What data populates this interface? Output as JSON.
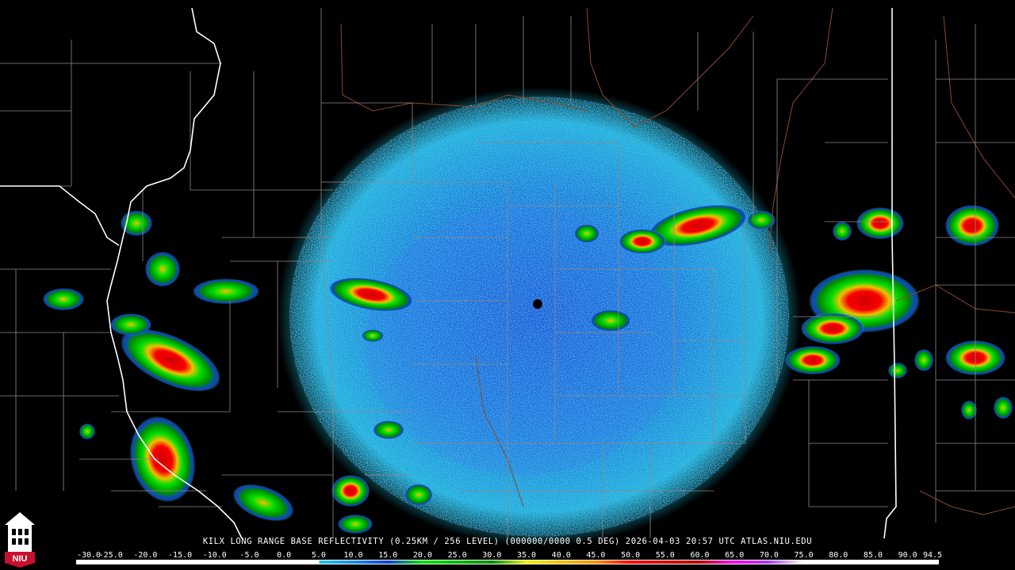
{
  "caption": "KILX LONG RANGE BASE REFLECTIVITY (0.25KM / 256 LEVEL) (000000/0000 0.5 DEG) 2026-04-03 20:57 UTC  ATLAS.NIU.EDU",
  "logo_text": "NIU",
  "scale": {
    "labels": [
      "-30.0",
      "-25.0",
      "-20.0",
      "-15.0",
      "-10.0",
      "-5.0",
      "0.0",
      "5.0",
      "10.0",
      "15.0",
      "20.0",
      "25.0",
      "30.0",
      "35.0",
      "40.0",
      "45.0",
      "50.0",
      "55.0",
      "60.0",
      "65.0",
      "70.0",
      "75.0",
      "80.0",
      "85.0",
      "90.0",
      "94.5"
    ],
    "min": -30.0,
    "max": 94.5,
    "stops": [
      {
        "v": -30,
        "c": "#ffffff"
      },
      {
        "v": 5,
        "c": "#ffffff"
      },
      {
        "v": 5,
        "c": "#22c8e0"
      },
      {
        "v": 10,
        "c": "#1a90e0"
      },
      {
        "v": 15,
        "c": "#1040d0"
      },
      {
        "v": 20,
        "c": "#00e000"
      },
      {
        "v": 25,
        "c": "#00b800"
      },
      {
        "v": 30,
        "c": "#008c00"
      },
      {
        "v": 35,
        "c": "#f8f000"
      },
      {
        "v": 40,
        "c": "#f0c000"
      },
      {
        "v": 45,
        "c": "#f89000"
      },
      {
        "v": 50,
        "c": "#f80000"
      },
      {
        "v": 55,
        "c": "#d00000"
      },
      {
        "v": 60,
        "c": "#b00000"
      },
      {
        "v": 65,
        "c": "#f800f8"
      },
      {
        "v": 70,
        "c": "#a040e0"
      },
      {
        "v": 75,
        "c": "#ffffff"
      },
      {
        "v": 94.5,
        "c": "#ffffff"
      }
    ]
  },
  "colors": {
    "background": "#000000",
    "county_lines": "#8a8a8a",
    "state_lines": "#ffffff",
    "rivers": "#8b4a2a",
    "radar_site": "#000000"
  },
  "map": {
    "radar_site": "KILX",
    "echo_field": {
      "type": "clear-air circular echo pattern",
      "max_range_ring_km": 230
    },
    "storms": [
      {
        "name": "storm-west-bands",
        "max_dbz": 55
      },
      {
        "name": "storm-central-west",
        "max_dbz": 50
      },
      {
        "name": "storm-north-east-line",
        "max_dbz": 55
      },
      {
        "name": "storm-east-cluster",
        "max_dbz": 55
      },
      {
        "name": "storm-southwest",
        "max_dbz": 55
      },
      {
        "name": "storm-far-east",
        "max_dbz": 55
      }
    ]
  }
}
